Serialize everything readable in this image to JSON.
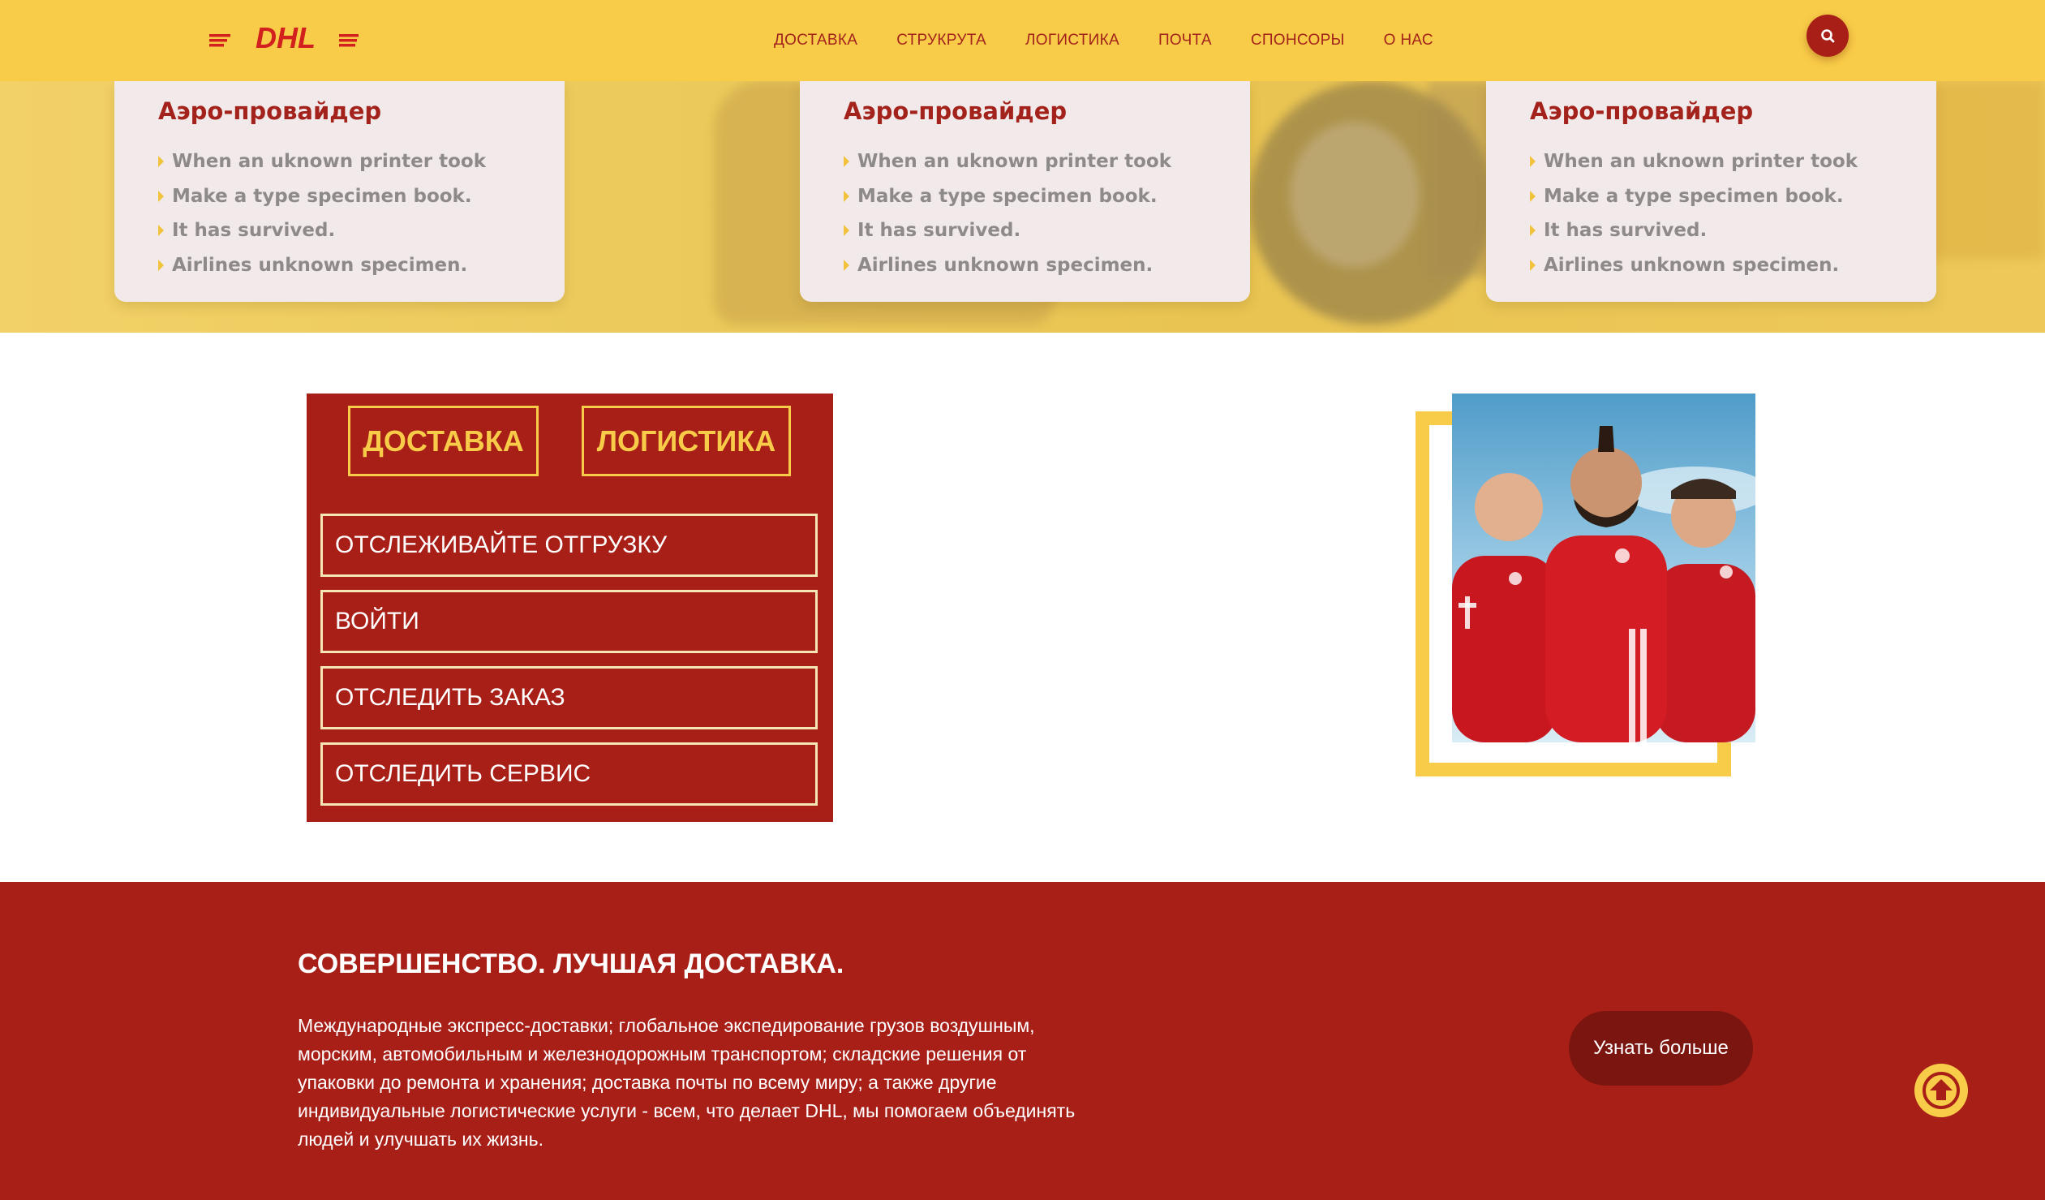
{
  "header": {
    "logo_text": "DHL",
    "nav": [
      "ДОСТАВКА",
      "СТРУКРУТА",
      "ЛОГИСТИКА",
      "ПОЧТА",
      "СПОНСОРЫ",
      "О НАС"
    ],
    "search_icon": "search-icon"
  },
  "cards": [
    {
      "title": "Аэро-провайдер",
      "items": [
        "When an uknown printer took",
        "Make a type specimen book.",
        "It has survived.",
        "Airlines unknown specimen."
      ]
    },
    {
      "title": "Аэро-провайдер",
      "items": [
        "When an uknown printer took",
        "Make a type specimen book.",
        "It has survived.",
        "Airlines unknown specimen."
      ]
    },
    {
      "title": "Аэро-провайдер",
      "items": [
        "When an uknown printer took",
        "Make a type specimen book.",
        "It has survived.",
        "Airlines unknown specimen."
      ]
    }
  ],
  "panel": {
    "tabs": [
      "ДОСТАВКА",
      "ЛОГИСТИКА"
    ],
    "actions": [
      "ОТСЛЕЖИВАЙТЕ ОТГРУЗКУ",
      "ВОЙТИ",
      "ОТСЛЕДИТЬ ЗАКАЗ",
      "ОТСЛЕДИТЬ СЕРВИС"
    ]
  },
  "footer": {
    "title": "СОВЕРШЕНСТВО. ЛУЧШАЯ ДОСТАВКА.",
    "text": "Международные экспресс-доставки; глобальное экспедирование грузов воздушным, морским, автомобильным и железнодорожным транспортом; складские решения от упаковки до ремонта и хранения; доставка почты по всему миру; а также другие индивидуальные логистические услуги - всем, что делает DHL, мы помогаем объединять людей и улучшать их жизнь.",
    "button": "Узнать больше",
    "scroll_up_icon": "arrow-up-icon"
  },
  "colors": {
    "brand_yellow": "#f8cc48",
    "brand_red": "#a81f18",
    "dark_red": "#7b150f",
    "card_bg": "#f2eaea",
    "list_gray": "#8e8a8a"
  }
}
